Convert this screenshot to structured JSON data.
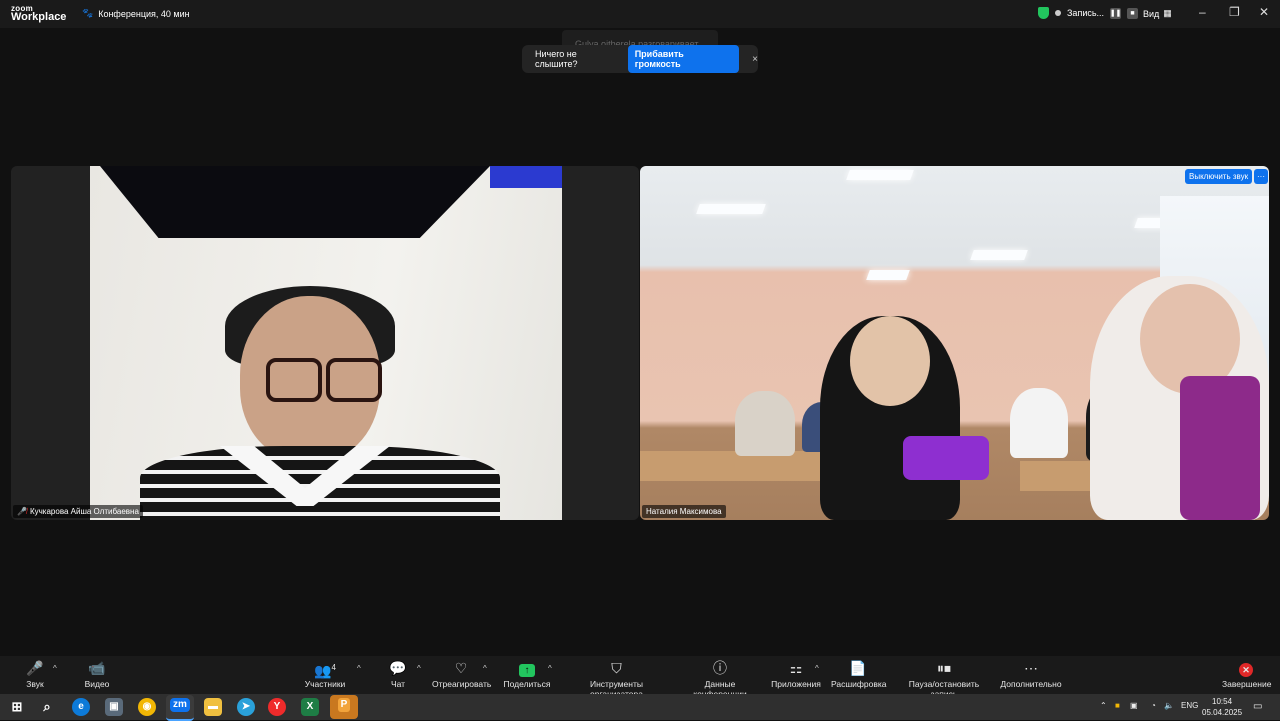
{
  "app": {
    "logo_top": "zoom",
    "logo_bottom": "Workplace",
    "meeting_title": "Конференция, 40 мин"
  },
  "header": {
    "recording_label": "Запись...",
    "view_label": "Вид"
  },
  "toast": {
    "ghost_text": "Gulya oitberela разговаривает...",
    "message": "Ничего не слышите?",
    "action": "Прибавить громкость",
    "close": "×"
  },
  "participants": [
    {
      "name": "Кучкарова Айша Олтибаевна",
      "muted": true
    },
    {
      "name": "Наталия Максимова",
      "mute_button": "Выключить звук",
      "more_button": "···"
    }
  ],
  "toolbar": {
    "audio": "Звук",
    "video": "Видео",
    "participants": "Участники",
    "participants_count": "4",
    "chat": "Чат",
    "react": "Отреагировать",
    "share": "Поделиться",
    "host_tools": "Инструменты организатора",
    "meeting_info": "Данные конференции",
    "apps": "Приложения",
    "captions": "Расшифровка",
    "pause_stop": "Пауза/остановить запись",
    "more": "Дополнительно",
    "end": "Завершение"
  },
  "taskbar": {
    "lang": "ENG",
    "time": "10:54",
    "date": "05.04.2025"
  },
  "colors": {
    "accent": "#0e72ed",
    "share": "#22c55e",
    "danger": "#e02828",
    "bg": "#111111"
  }
}
